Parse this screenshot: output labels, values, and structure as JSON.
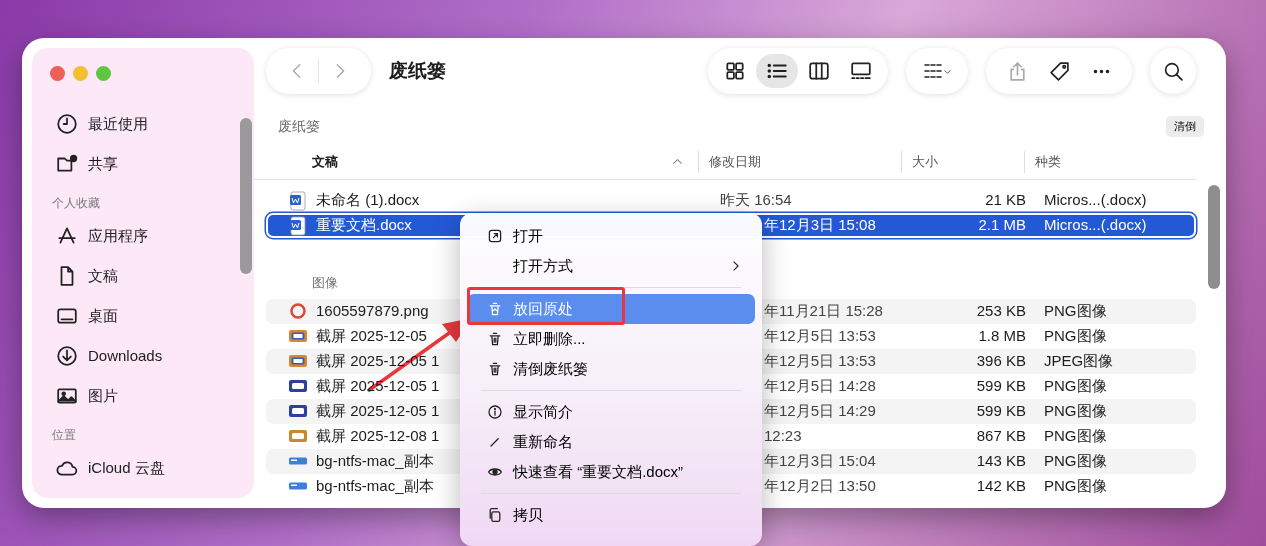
{
  "window": {
    "title": "废纸篓"
  },
  "toolbar": {
    "views": [
      {
        "kind": "icons",
        "selected": false
      },
      {
        "kind": "list",
        "selected": true
      },
      {
        "kind": "columns",
        "selected": false
      },
      {
        "kind": "gallery",
        "selected": false
      }
    ]
  },
  "sidebar": {
    "sections": [
      {
        "items": [
          {
            "label": "最近使用",
            "kind": "clock"
          },
          {
            "label": "共享",
            "kind": "shared"
          }
        ]
      },
      {
        "heading": "个人收藏",
        "items": [
          {
            "label": "应用程序",
            "kind": "apps"
          },
          {
            "label": "文稿",
            "kind": "doc"
          },
          {
            "label": "桌面",
            "kind": "desktop"
          },
          {
            "label": "Downloads",
            "kind": "download"
          },
          {
            "label": "图片",
            "kind": "photo"
          }
        ]
      },
      {
        "heading": "位置",
        "items": [
          {
            "label": "iCloud 云盘",
            "kind": "cloud"
          }
        ]
      }
    ]
  },
  "location": {
    "title": "废纸篓",
    "button": "清倒"
  },
  "table": {
    "columns": [
      {
        "label": "文稿",
        "sorted": true
      },
      {
        "label": "修改日期",
        "sorted": false
      },
      {
        "label": "大小",
        "sorted": false
      },
      {
        "label": "种类",
        "sorted": false
      }
    ],
    "groups": [
      {
        "rows": [
          {
            "name": "未命名 (1).docx",
            "date": "昨天 16:54",
            "size": "21 KB",
            "kind": "Micros...(.docx)",
            "selected": false
          },
          {
            "name": "重要文档.docx",
            "date": "年12月3日 15:08",
            "size": "2.1 MB",
            "kind": "Micros...(.docx)",
            "selected": true
          }
        ]
      },
      {
        "heading": "图像",
        "rows": [
          {
            "name": "1605597879.png",
            "date": "年11月21日 15:28",
            "size": "253 KB",
            "kind": "PNG图像",
            "selected": false
          },
          {
            "name": "截屏 2025-12-05",
            "date": "年12月5日 13:53",
            "size": "1.8 MB",
            "kind": "PNG图像",
            "selected": false
          },
          {
            "name": "截屏 2025-12-05 1",
            "date": "年12月5日 13:53",
            "size": "396 KB",
            "kind": "JPEG图像",
            "selected": false
          },
          {
            "name": "截屏 2025-12-05 1",
            "date": "年12月5日 14:28",
            "size": "599 KB",
            "kind": "PNG图像",
            "selected": false
          },
          {
            "name": "截屏 2025-12-05 1",
            "date": "年12月5日 14:29",
            "size": "599 KB",
            "kind": "PNG图像",
            "selected": false
          },
          {
            "name": "截屏 2025-12-08 1",
            "date": "12:23",
            "size": "867 KB",
            "kind": "PNG图像",
            "selected": false
          },
          {
            "name": "bg-ntfs-mac_副本",
            "date": "年12月3日 15:04",
            "size": "143 KB",
            "kind": "PNG图像",
            "selected": false
          },
          {
            "name": "bg-ntfs-mac_副本",
            "date": "年12月2日 13:50",
            "size": "142 KB",
            "kind": "PNG图像",
            "selected": false
          }
        ]
      }
    ]
  },
  "context_menu": {
    "items": [
      {
        "kind": "item",
        "label": "打开",
        "selected": false
      },
      {
        "kind": "submenu",
        "label": "打开方式",
        "selected": false
      },
      {
        "kind": "separator"
      },
      {
        "kind": "item",
        "label": "放回原处",
        "selected": true
      },
      {
        "kind": "item",
        "label": "立即删除...",
        "selected": false
      },
      {
        "kind": "item",
        "label": "清倒废纸篓",
        "selected": false
      },
      {
        "kind": "separator"
      },
      {
        "kind": "item",
        "label": "显示简介",
        "selected": false
      },
      {
        "kind": "item",
        "label": "重新命名",
        "selected": false
      },
      {
        "kind": "item",
        "label": "快速查看 “重要文档.docx”",
        "selected": false
      },
      {
        "kind": "separator"
      },
      {
        "kind": "item",
        "label": "拷贝",
        "selected": false
      }
    ]
  }
}
